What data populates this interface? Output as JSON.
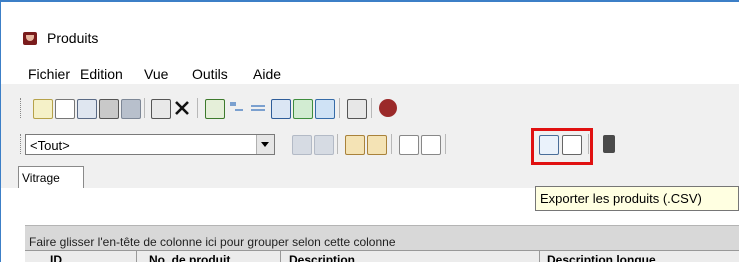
{
  "window": {
    "title": "Produits",
    "icon": "app-logo-icon",
    "accent": "#3c7fc7"
  },
  "menu": [
    "Fichier",
    "Edition",
    "Vue",
    "Outils",
    "Aide"
  ],
  "toolbar1": [
    "new-icon",
    "preview-icon",
    "print-icon",
    "properties-icon",
    "save-icon",
    "copy-icon",
    "delete-icon",
    "refresh-icon",
    "sort-icon",
    "filter-icon",
    "view-icon",
    "list-icon",
    "grid-icon",
    "settings-icon",
    "info-icon"
  ],
  "filter": {
    "value": "<Tout>"
  },
  "toolbar2": [
    "nav-first-icon",
    "nav-prev-icon",
    "nav-next-icon",
    "nav-last-icon",
    "import-icon",
    "export-icon",
    "export-csv-icon",
    "import-csv-icon",
    "traffic-light-icon"
  ],
  "tab": {
    "label": "Vitrage"
  },
  "grid": {
    "group_hint": "Faire glisser l'en-tête de colonne ici pour grouper selon cette colonne",
    "columns": [
      "ID",
      "No. de produit",
      "Description",
      "Description longue"
    ]
  },
  "tooltip": {
    "text": "Exporter les produits (.CSV)"
  },
  "colors": {
    "highlight": "#e01010",
    "tooltip_bg": "#ffffe1"
  }
}
